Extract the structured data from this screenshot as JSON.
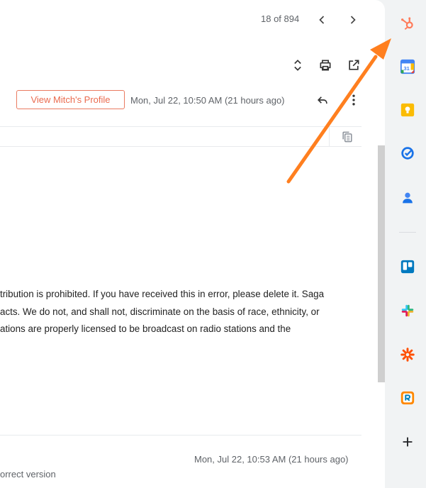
{
  "toolbar": {
    "pagination": "18 of 894",
    "prev_icon": "chevron-left-icon",
    "next_icon": "chevron-right-icon",
    "expand_icon": "unfold-icon",
    "print_icon": "print-icon",
    "open_new_window_icon": "open-in-new-icon"
  },
  "message": {
    "profile_button": "View Mitch's Profile",
    "datetime": "Mon, Jul 22, 10:50 AM (21 hours ago)",
    "reply_icon": "reply-icon",
    "more_icon": "more-vert-icon",
    "copy_icon": "copy-icon",
    "body_lines": [
      "tribution is prohibited. If you have received this in error, please delete it. Saga",
      "acts. We do not, and shall not, discriminate on the basis of race, ethnicity, or",
      "ations are properly licensed to be broadcast on radio stations and the"
    ]
  },
  "next_message": {
    "datetime": "Mon, Jul 22, 10:53 AM (21 hours ago)",
    "snippet": "orrect version"
  },
  "sidebar": {
    "apps": [
      {
        "name": "hubspot-icon"
      },
      {
        "name": "google-calendar-icon",
        "label": "31"
      },
      {
        "name": "google-keep-icon"
      },
      {
        "name": "google-tasks-icon"
      },
      {
        "name": "google-contacts-icon"
      },
      {
        "name": "trello-icon"
      },
      {
        "name": "slack-icon"
      },
      {
        "name": "zapier-icon"
      },
      {
        "name": "ringcentral-icon"
      },
      {
        "name": "add-icon"
      }
    ]
  },
  "colors": {
    "accent_orange": "#ff7a1a",
    "profile_border": "#ea7b61",
    "sidebar_bg": "#f1f3f4"
  }
}
